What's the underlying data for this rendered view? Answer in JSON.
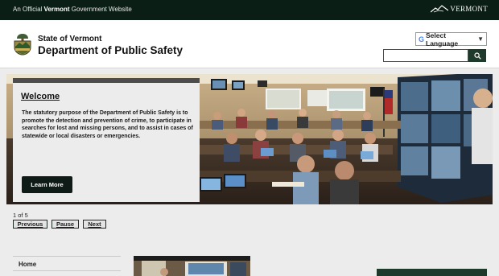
{
  "topbar": {
    "official_prefix": "An Official",
    "official_state": "Vermont",
    "official_suffix": "Government Website",
    "logo_text": "VERMONT",
    "logo_icon": "mountain-line-icon"
  },
  "header": {
    "state_name": "State of Vermont",
    "dept_name": "Department of Public Safety",
    "seal_icon": "vermont-seal-icon"
  },
  "language": {
    "label": "Select Language",
    "google_letter": "G",
    "arrow": "▼"
  },
  "search": {
    "placeholder": "",
    "icon": "search-icon"
  },
  "slide": {
    "title": "Welcome",
    "body": "The statutory purpose of the Department of Public Safety is to promote the detection and prevention of crime, to participate in searches for lost and missing persons, and to assist in cases of statewide or local disasters or emergencies.",
    "button": "Learn More"
  },
  "slider_controls": {
    "counter": "1 of 5",
    "previous": "Previous",
    "pause": "Pause",
    "next": "Next"
  },
  "sidebar": {
    "home": "Home"
  },
  "colors": {
    "topbar": "#0b1e15",
    "brand_green": "#1d3a2a",
    "button_dark": "#0f1b16",
    "page_bg": "#ececec"
  }
}
